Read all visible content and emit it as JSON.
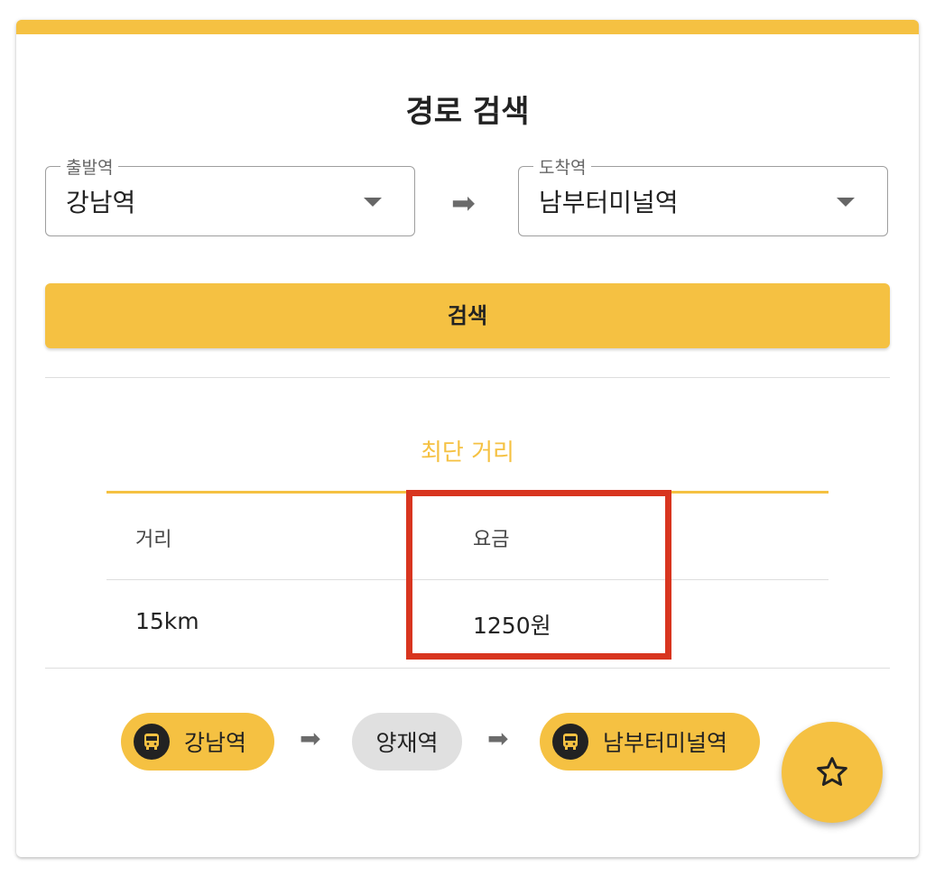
{
  "page": {
    "title": "경로 검색"
  },
  "search_form": {
    "departure": {
      "label": "출발역",
      "value": "강남역"
    },
    "arrival": {
      "label": "도착역",
      "value": "남부터미널역"
    },
    "direction_icon": "arrow-right-icon",
    "search_button_label": "검색"
  },
  "result": {
    "tab_label": "최단 거리",
    "columns": [
      "거리",
      "요금"
    ],
    "rows": [
      [
        "15km",
        "1250원"
      ]
    ]
  },
  "route": {
    "stations": [
      {
        "name": "강남역",
        "icon": "subway-icon",
        "highlight": true
      },
      {
        "name": "양재역",
        "icon": "",
        "highlight": false
      },
      {
        "name": "남부터미널역",
        "icon": "subway-icon",
        "highlight": true
      }
    ]
  },
  "favorite_button": {
    "icon": "star-icon"
  },
  "colors": {
    "accent": "#f5c142",
    "highlight_box": "#d8351f",
    "chip_neutral": "#e0e0e0"
  }
}
